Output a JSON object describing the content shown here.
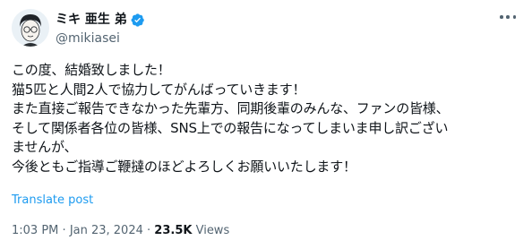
{
  "author": {
    "display_name": "ミキ 亜生 弟",
    "handle": "@mikiasei",
    "verified": true
  },
  "tweet": {
    "lines": [
      "この度、結婚致しました！",
      "猫5匹と人間2人で協力してがんばっていきます！",
      "また直接ご報告できなかった先輩方、同期後輩のみんな、ファンの皆様、",
      "そして関係者各位の皆様、SNS上での報告になってしまいま申し訳ござい",
      "ませんが、",
      "今後ともご指導ご鞭撻のほどよろしくお願いいたします！"
    ]
  },
  "translate_label": "Translate post",
  "meta": {
    "time": "1:03 PM",
    "separator": "·",
    "date": "Jan 23, 2024",
    "views_count": "23.5K",
    "views_label": "Views"
  },
  "icons": {
    "verified": "verified-badge-icon",
    "more": "more-horizontal-icon"
  },
  "colors": {
    "accent": "#1d9bf0",
    "text": "#0f1419",
    "secondary": "#536471"
  }
}
